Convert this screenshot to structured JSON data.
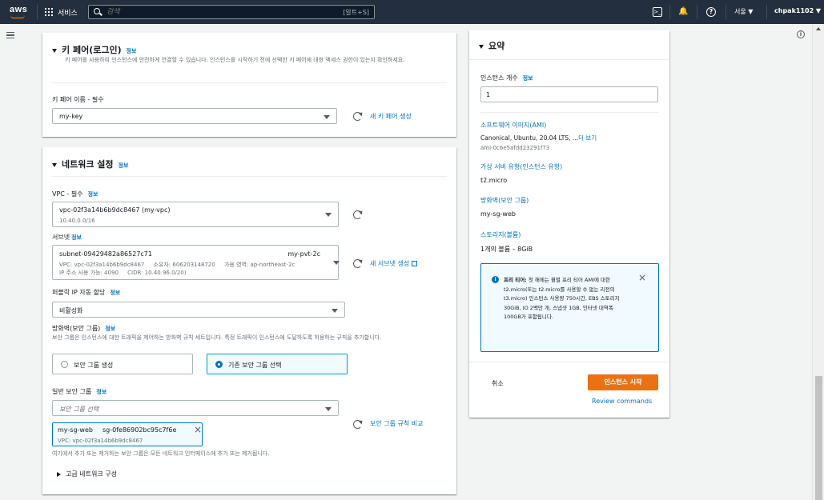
{
  "nav": {
    "logo": "aws",
    "services": "서비스",
    "search_placeholder": "검색",
    "search_shortcut": "[알트+S]",
    "region": "서울 ▼",
    "user": "chpak1102 ▼"
  },
  "keypair": {
    "title": "키 페어(로그인)",
    "info": "정보",
    "desc": "키 페어를 사용하여 인스턴스에 안전하게 연결할 수 있습니다. 인스턴스를 시작하기 전에 선택한 키 페어에 대한 액세스 권한이 있는지 확인하세요.",
    "label": "키 페어 이름 - 필수",
    "value": "my-key",
    "create_link": "새 키 페어 생성"
  },
  "network": {
    "title": "네트워크 설정",
    "info": "정보",
    "vpc_label": "VPC - 필수",
    "vpc_info": "정보",
    "vpc_value": "vpc-02f3a14b6b9dc8467 (my-vpc)",
    "vpc_cidr": "10.40.0.0/16",
    "subnet_label": "서브넷",
    "subnet_info": "정보",
    "subnet_id": "subnet-09429482a86527c71",
    "subnet_name": "my-pvt-2c",
    "subnet_line2": "VPC: vpc-02f3a14b6b9dc8467     소유자: 606203148720     가용 영역: ap-northeast-2c",
    "subnet_line3": "IP 주소 사용 가능: 4090     CIDR: 10.40.96.0/20)",
    "subnet_create": "새 서브넷 생성",
    "public_ip_label": "퍼블릭 IP 자동 할당",
    "public_ip_info": "정보",
    "public_ip_value": "비활성화",
    "sg_label": "방화벽(보안 그룹)",
    "sg_info": "정보",
    "sg_desc": "보안 그룹은 인스턴스에 대한 트래픽을 제어하는 방화벽 규칙 세트입니다. 특정 트래픽이 인스턴스에 도달하도록 허용하는 규칙을 추가합니다.",
    "sg_create": "보안 그룹 생성",
    "sg_existing": "기존 보안 그룹 선택",
    "common_sg_label": "일반 보안 그룹",
    "common_sg_info": "정보",
    "common_sg_placeholder": "보안 그룹 선택",
    "token_name": "my-sg-web",
    "token_id": "sg-0fe86902bc95c7f6e",
    "token_vpc": "VPC: vpc-02f3a14b6b9dc8467",
    "compare_link": "보안 그룹 규칙 비교",
    "sg_note": "여기에서 추가 또는 제거하는 보안 그룹은 모든 네트워크 인터페이스에 추가 또는 제거됩니다.",
    "advanced": "고급 네트워크 구성"
  },
  "summary": {
    "title": "요약",
    "count_label": "인스턴스 개수",
    "count_info": "정보",
    "count_value": "1",
    "ami_link": "소프트웨어 이미지(AMI)",
    "ami_desc": "Canonical, Ubuntu, 20.04 LTS, ...",
    "ami_more": "더 보기",
    "ami_id": "ami-0c6e5afdd23291f73",
    "type_link": "가상 서버 유형(인스턴스 유형)",
    "type_value": "t2.micro",
    "fw_link": "방화벽(보안 그룹)",
    "fw_value": "my-sg-web",
    "storage_link": "스토리지(볼륨)",
    "storage_value": "1개의 볼륨 – 8GiB",
    "freetier_bold": "프리 티어:",
    "freetier_text": "첫 해에는 월별 프리 티어 AMI에 대한 t2.micro(또는 t2.micro를 사용할 수 없는 리전의 t3.micro) 인스턴스 사용량 750시간, EBS 스토리지 30GiB, IO 2백만 개, 스냅샷 1GB, 인터넷 대역폭 100GB가 포함됩니다.",
    "cancel": "취소",
    "launch": "인스턴스 시작",
    "review": "Review commands"
  },
  "colors": {
    "nav_bg": "#232f3e",
    "link": "#0073bb",
    "primary": "#ec7211"
  }
}
